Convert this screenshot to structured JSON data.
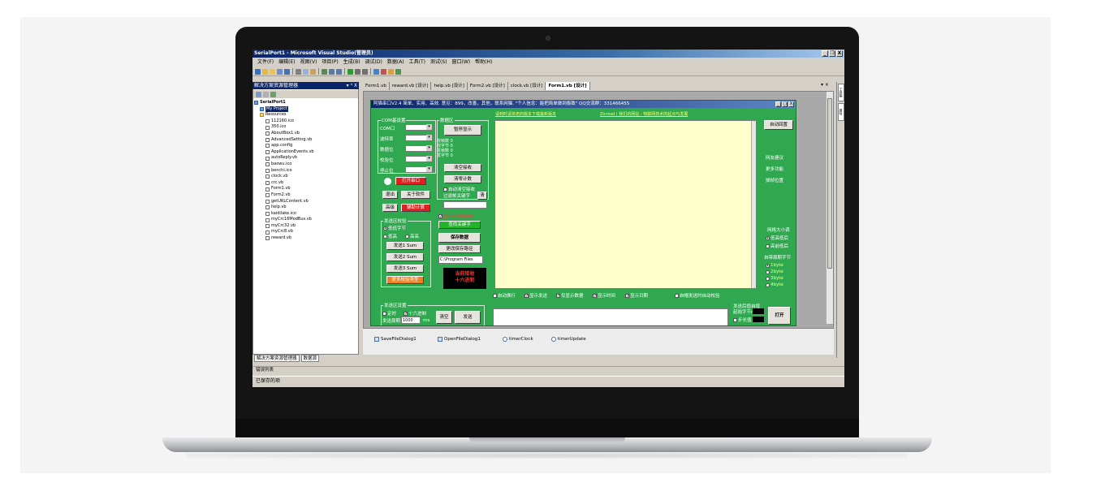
{
  "window": {
    "title": "SerialPort1 - Microsoft Visual Studio(管理员)",
    "controls": [
      "_",
      "❐",
      "X"
    ]
  },
  "menu": [
    "文件(F)",
    "编辑(E)",
    "视图(V)",
    "项目(P)",
    "生成(B)",
    "调试(D)",
    "数据(A)",
    "工具(T)",
    "测试(S)",
    "窗口(W)",
    "帮助(H)"
  ],
  "solution_explorer": {
    "title": "解决方案资源管理器",
    "pin": "▾ ⁴ X",
    "solution": "SerialPort1",
    "items": [
      {
        "label": "My Project",
        "icon": "proj"
      },
      {
        "label": "Resources",
        "icon": "folder"
      },
      {
        "label": "112160.ico",
        "icon": "file"
      },
      {
        "label": "350.ico",
        "icon": "file"
      },
      {
        "label": "AboutBox1.vb",
        "icon": "file"
      },
      {
        "label": "AdvancedSetting.vb",
        "icon": "file"
      },
      {
        "label": "app.config",
        "icon": "file"
      },
      {
        "label": "ApplicationEvents.vb",
        "icon": "file"
      },
      {
        "label": "autoReply.vb",
        "icon": "file"
      },
      {
        "label": "baowu.ico",
        "icon": "file"
      },
      {
        "label": "benchi.ico",
        "icon": "file"
      },
      {
        "label": "clock.vb",
        "icon": "file"
      },
      {
        "label": "crc.vb",
        "icon": "file"
      },
      {
        "label": "Form1.vb",
        "icon": "file"
      },
      {
        "label": "Form2.vb",
        "icon": "file"
      },
      {
        "label": "getURLContent.vb",
        "icon": "file"
      },
      {
        "label": "help.vb",
        "icon": "file"
      },
      {
        "label": "kaidilake.ico",
        "icon": "file"
      },
      {
        "label": "myCrc16ModBus.vb",
        "icon": "file"
      },
      {
        "label": "myCrc32.vb",
        "icon": "file"
      },
      {
        "label": "myCrc8.vb",
        "icon": "file"
      },
      {
        "label": "reward.vb",
        "icon": "file"
      }
    ],
    "bottom_tabs": [
      "解决方案资源管理器",
      "数据源"
    ]
  },
  "error_list": "错误列表",
  "status": "已保存的项",
  "doc_tabs": {
    "tabs": [
      "Form1.vb",
      "reward.vb [设计]",
      "help.vb [设计]",
      "Form2.vb [设计]",
      "clock.vb [设计]",
      "Form1.vb [设计]"
    ],
    "active_index": 5,
    "close": "▾ × "
  },
  "right_strip": [
    "工具箱",
    "属性"
  ],
  "form": {
    "title": "阿猫串口V2.4  简单、实用、高效.  意见：899，改善，其他，联系网猫. \"个人信念：能把简单做到极致\" QQ交流群：331466455",
    "controls": [
      "_",
      "□",
      "X"
    ],
    "links": {
      "update": "请到时请将老的版本下载最新版本",
      "blog": "Zicrosd | 我们的网站 - 物联网技术的起点与发展"
    },
    "com_group": {
      "title": "COM基设置",
      "labels": [
        "COM口",
        "波特率",
        "数据位",
        "校验位",
        "停止位"
      ],
      "open_port": "打开串口"
    },
    "data_area": {
      "title": "数据区",
      "pause": "暂停显示",
      "stats": [
        "收帧数 0",
        "收字节 0",
        "发帧数 0",
        "发字节 0"
      ],
      "clear_recv": "清空接收",
      "clear_count": "清零计数",
      "auto_clear": "自动清空接收",
      "filter_label": "过滤帧关键字",
      "filter_btn": "清"
    },
    "left_buttons": {
      "exit": "退出",
      "about": "关于软件",
      "advanced": "高级",
      "detail": "辅助计算"
    },
    "send_group": {
      "title": "发送区校验",
      "radio_low": "低低字节",
      "radio_high": "低高",
      "radio_high2": "高高",
      "send1": "发送1 Sum",
      "send2": "发送2 Sum",
      "send3": "发送3 Sum",
      "more": "更多校验类型"
    },
    "keyword": {
      "show_check": "显示接收关键字",
      "find": "查找关键字",
      "save": "保存数据",
      "change_path": "更改保存路径",
      "path": "C:\\Program Files"
    },
    "hex_box": [
      "当前接收",
      "十六进制"
    ],
    "right_panel": {
      "auto_scroll": "自动回置",
      "links": [
        "网友建议",
        "更多功能",
        "掉帧位置"
      ],
      "window_size_title": "网格大小调",
      "win_low": "低高低后",
      "win_high": "高前低后",
      "byte_title": "自带周期字节",
      "bytes": [
        "1byte",
        "2byte",
        "3byte",
        "4byte"
      ]
    },
    "recv_options": [
      "自动换行",
      "显示发送",
      "仅显示数据",
      "显示时间",
      "显示日期"
    ],
    "recv_checked": [
      false,
      true,
      true,
      true,
      true
    ],
    "auto_send_check": "自帽发送时自动校验",
    "send_settings": {
      "title": "发送区设置",
      "timer": "定时",
      "hex": "十六进制",
      "interval_label": "发送周期",
      "interval": "1000",
      "unit": "ms",
      "clear": "清空",
      "send": "发送"
    },
    "after_send": {
      "title": "发送后值自增",
      "start_byte": "起始字节n",
      "step": "步长值",
      "open": "打开"
    }
  },
  "tray": [
    "SaveFileDialog1",
    "OpenFileDialog1",
    "timerClock",
    "timerUpdate"
  ],
  "colors": {
    "form_bg": "#2fa84f",
    "recv_bg": "#ffffcc",
    "titlebar": "#0a246a"
  }
}
